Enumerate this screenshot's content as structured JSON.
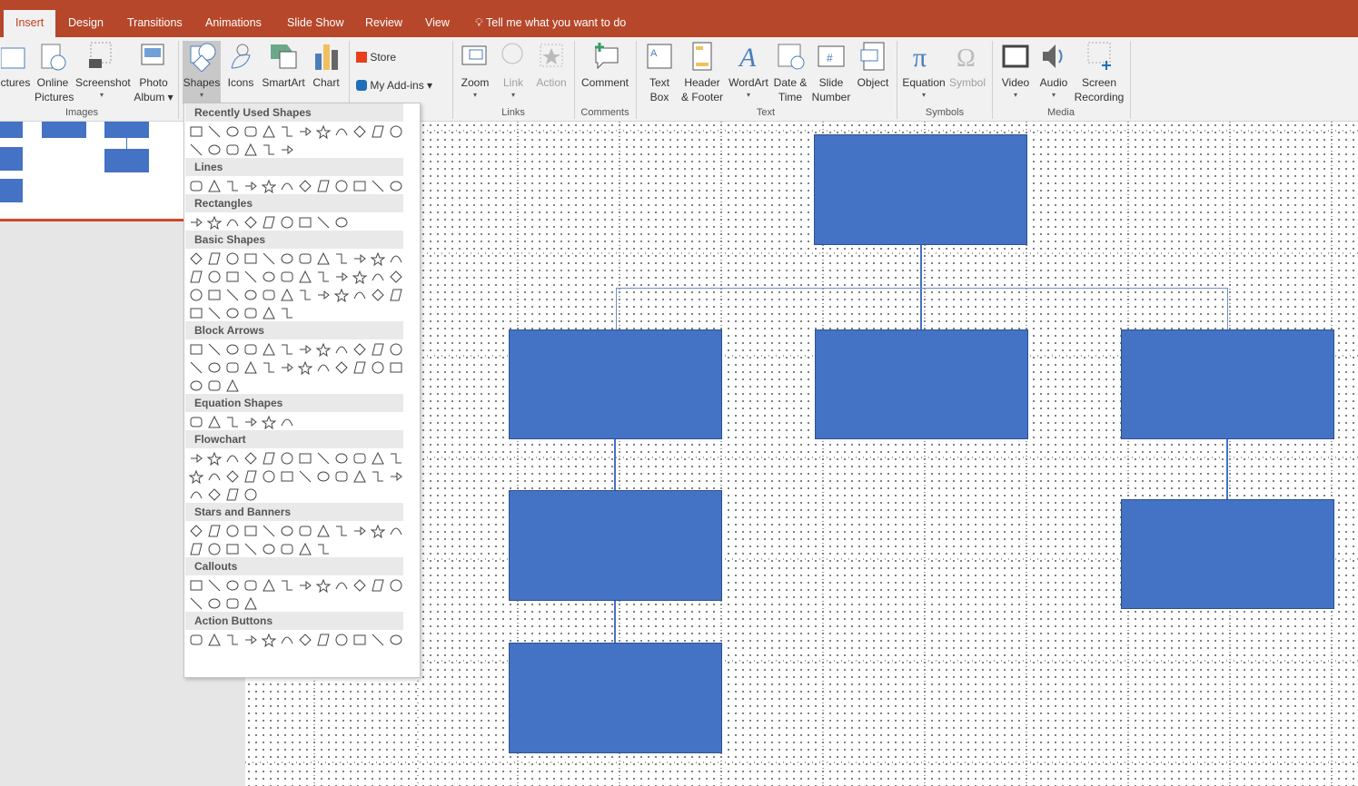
{
  "tabs": [
    {
      "label": "Insert",
      "active": true
    },
    {
      "label": "Design"
    },
    {
      "label": "Transitions"
    },
    {
      "label": "Animations"
    },
    {
      "label": "Slide Show"
    },
    {
      "label": "Review"
    },
    {
      "label": "View"
    }
  ],
  "tell_me": "Tell me what you want to do",
  "ribbon": {
    "images": {
      "label": "Images",
      "pictures": "ctures",
      "online": "Online",
      "online2": "Pictures",
      "screenshot": "Screenshot",
      "photo": "Photo",
      "photo2": "Album"
    },
    "illus": {
      "shapes": "Shapes",
      "icons": "Icons",
      "smartart": "SmartArt",
      "chart": "Chart"
    },
    "addins": {
      "store": "Store",
      "myaddins": "My Add-ins"
    },
    "links": {
      "label": "Links",
      "zoom": "Zoom",
      "link": "Link",
      "action": "Action"
    },
    "comments": {
      "label": "Comments",
      "comment": "Comment"
    },
    "text": {
      "label": "Text",
      "textbox": "Text",
      "textbox2": "Box",
      "header": "Header",
      "header2": "& Footer",
      "wordart": "WordArt",
      "date": "Date &",
      "date2": "Time",
      "slide": "Slide",
      "slide2": "Number",
      "object": "Object"
    },
    "symbols": {
      "label": "Symbols",
      "equation": "Equation",
      "symbol": "Symbol"
    },
    "media": {
      "label": "Media",
      "video": "Video",
      "audio": "Audio",
      "screen": "Screen",
      "screen2": "Recording"
    }
  },
  "gallery": {
    "sections": [
      {
        "title": "Recently Used Shapes",
        "rows": [
          12,
          6
        ],
        "kinds": "textbox,line,arrow,rect,ellipse,rrect,triangle,elbow,elbow-arrow,right-arrow,down-arrow,freeform,scribble,arc,curve,brace-left,brace-right,star"
      },
      {
        "title": "Lines",
        "rows": [
          12
        ]
      },
      {
        "title": "Rectangles",
        "rows": [
          9
        ]
      },
      {
        "title": "Basic Shapes",
        "rows": [
          12,
          12,
          12,
          6
        ]
      },
      {
        "title": "Block Arrows",
        "rows": [
          12,
          12,
          3
        ]
      },
      {
        "title": "Equation Shapes",
        "rows": [
          6
        ]
      },
      {
        "title": "Flowchart",
        "rows": [
          12,
          12,
          4
        ]
      },
      {
        "title": "Stars and Banners",
        "rows": [
          12,
          8
        ]
      },
      {
        "title": "Callouts",
        "rows": [
          12,
          4
        ]
      },
      {
        "title": "Action Buttons",
        "rows": [
          12
        ]
      }
    ]
  },
  "colors": {
    "accent": "#b7472a",
    "shape_fill": "#4472c4",
    "shape_border": "#2f528f"
  }
}
